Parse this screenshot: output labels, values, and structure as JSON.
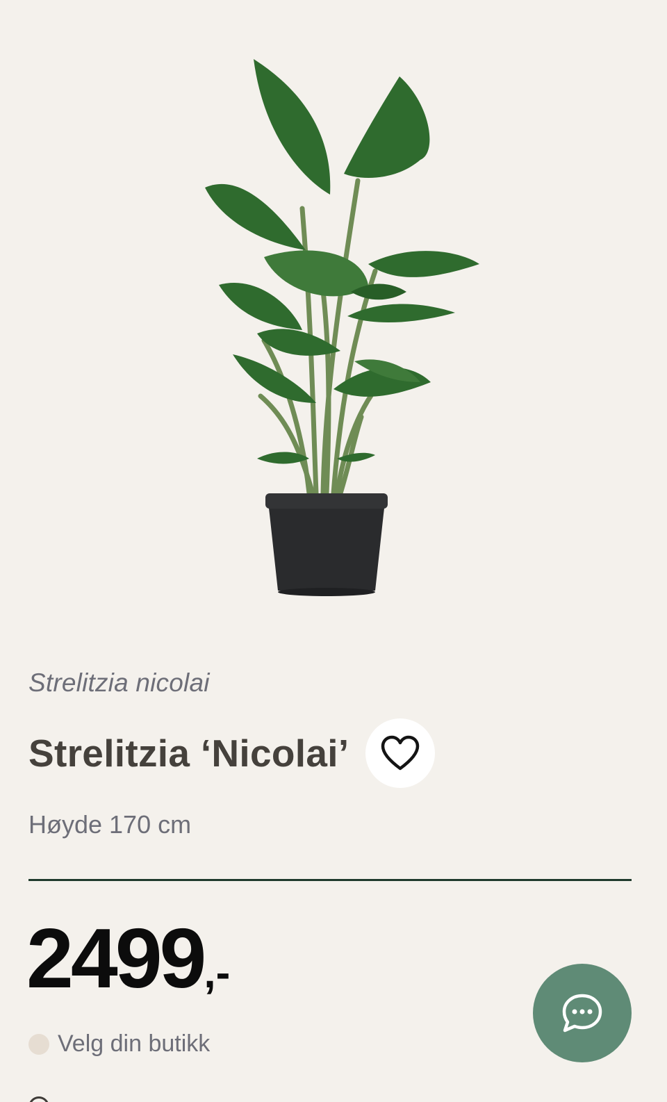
{
  "product": {
    "latin_name": "Strelitzia nicolai",
    "title": "Strelitzia ‘Nicolai’",
    "height": "Høyde 170 cm",
    "price_amount": "2499",
    "price_suffix": ",-",
    "image": "plant-in-black-pot"
  },
  "store": {
    "label": "Velg din butikk"
  },
  "icons": {
    "favorite": "heart-icon",
    "chat": "chat-bubble-icon"
  },
  "colors": {
    "background": "#f4f1ec",
    "chat_button": "#5f8b76",
    "divider": "#1f3a2c",
    "price": "#0c0c0c"
  }
}
